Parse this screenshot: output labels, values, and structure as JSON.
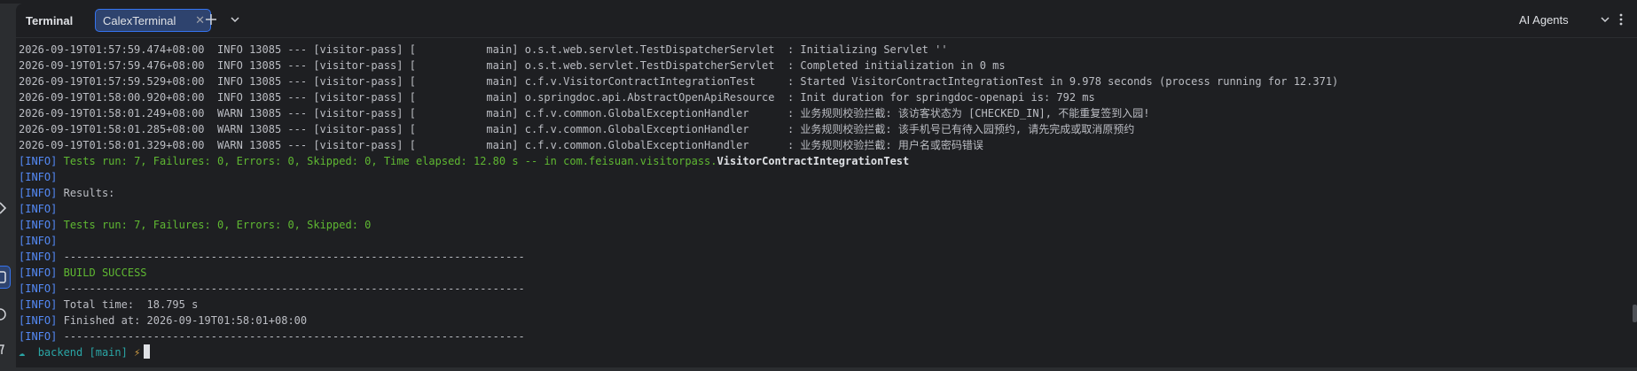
{
  "toolwindow": {
    "title": "Terminal",
    "tabs": [
      {
        "label": "CalexTerminal",
        "active": true
      }
    ],
    "agents_label": "AI Agents"
  },
  "icons": {
    "close": "close-icon",
    "add": "plus-icon",
    "dropdown": "chevron-down-icon",
    "more": "more-vertical-icon"
  },
  "colors": {
    "background": "#1e1f22",
    "info_tag": "#548af7",
    "success_green": "#5fb832",
    "prompt_cyan": "#2aa6a6",
    "accent": "#3574f0"
  },
  "console": {
    "log_lines": [
      "2026-09-19T01:57:59.474+08:00  INFO 13085 --- [visitor-pass] [           main] o.s.t.web.servlet.TestDispatcherServlet  : Initializing Servlet ''",
      "2026-09-19T01:57:59.476+08:00  INFO 13085 --- [visitor-pass] [           main] o.s.t.web.servlet.TestDispatcherServlet  : Completed initialization in 0 ms",
      "2026-09-19T01:57:59.529+08:00  INFO 13085 --- [visitor-pass] [           main] c.f.v.VisitorContractIntegrationTest     : Started VisitorContractIntegrationTest in 9.978 seconds (process running for 12.371)",
      "2026-09-19T01:58:00.920+08:00  INFO 13085 --- [visitor-pass] [           main] o.springdoc.api.AbstractOpenApiResource  : Init duration for springdoc-openapi is: 792 ms",
      "2026-09-19T01:58:01.249+08:00  WARN 13085 --- [visitor-pass] [           main] c.f.v.common.GlobalExceptionHandler      : 业务规则校验拦截: 该访客状态为 [CHECKED_IN], 不能重复签到入园!",
      "2026-09-19T01:58:01.285+08:00  WARN 13085 --- [visitor-pass] [           main] c.f.v.common.GlobalExceptionHandler      : 业务规则校验拦截: 该手机号已有待入园预约, 请先完成或取消原预约",
      "2026-09-19T01:58:01.329+08:00  WARN 13085 --- [visitor-pass] [           main] c.f.v.common.GlobalExceptionHandler      : 业务规则校验拦截: 用户名或密码错误"
    ],
    "info_tag": "[INFO]",
    "tests_line": {
      "summary": "Tests run: 7, Failures: 0, Errors: 0, Skipped: 0, Time elapsed: 12.80 s -- in com.feisuan.visitorpass.",
      "test_class": "VisitorContractIntegrationTest"
    },
    "results_label": "Results:",
    "tests_summary": "Tests run: 7, Failures: 0, Errors: 0, Skipped: 0",
    "separator": "------------------------------------------------------------------------",
    "build_status": "BUILD SUCCESS",
    "total_time": "Total time:  18.795 s",
    "finished_at": "Finished at: 2026-09-19T01:58:01+08:00",
    "prompt": {
      "symbol": "☁",
      "dir": "backend",
      "branch": "[main]",
      "flag": "⚡"
    }
  }
}
